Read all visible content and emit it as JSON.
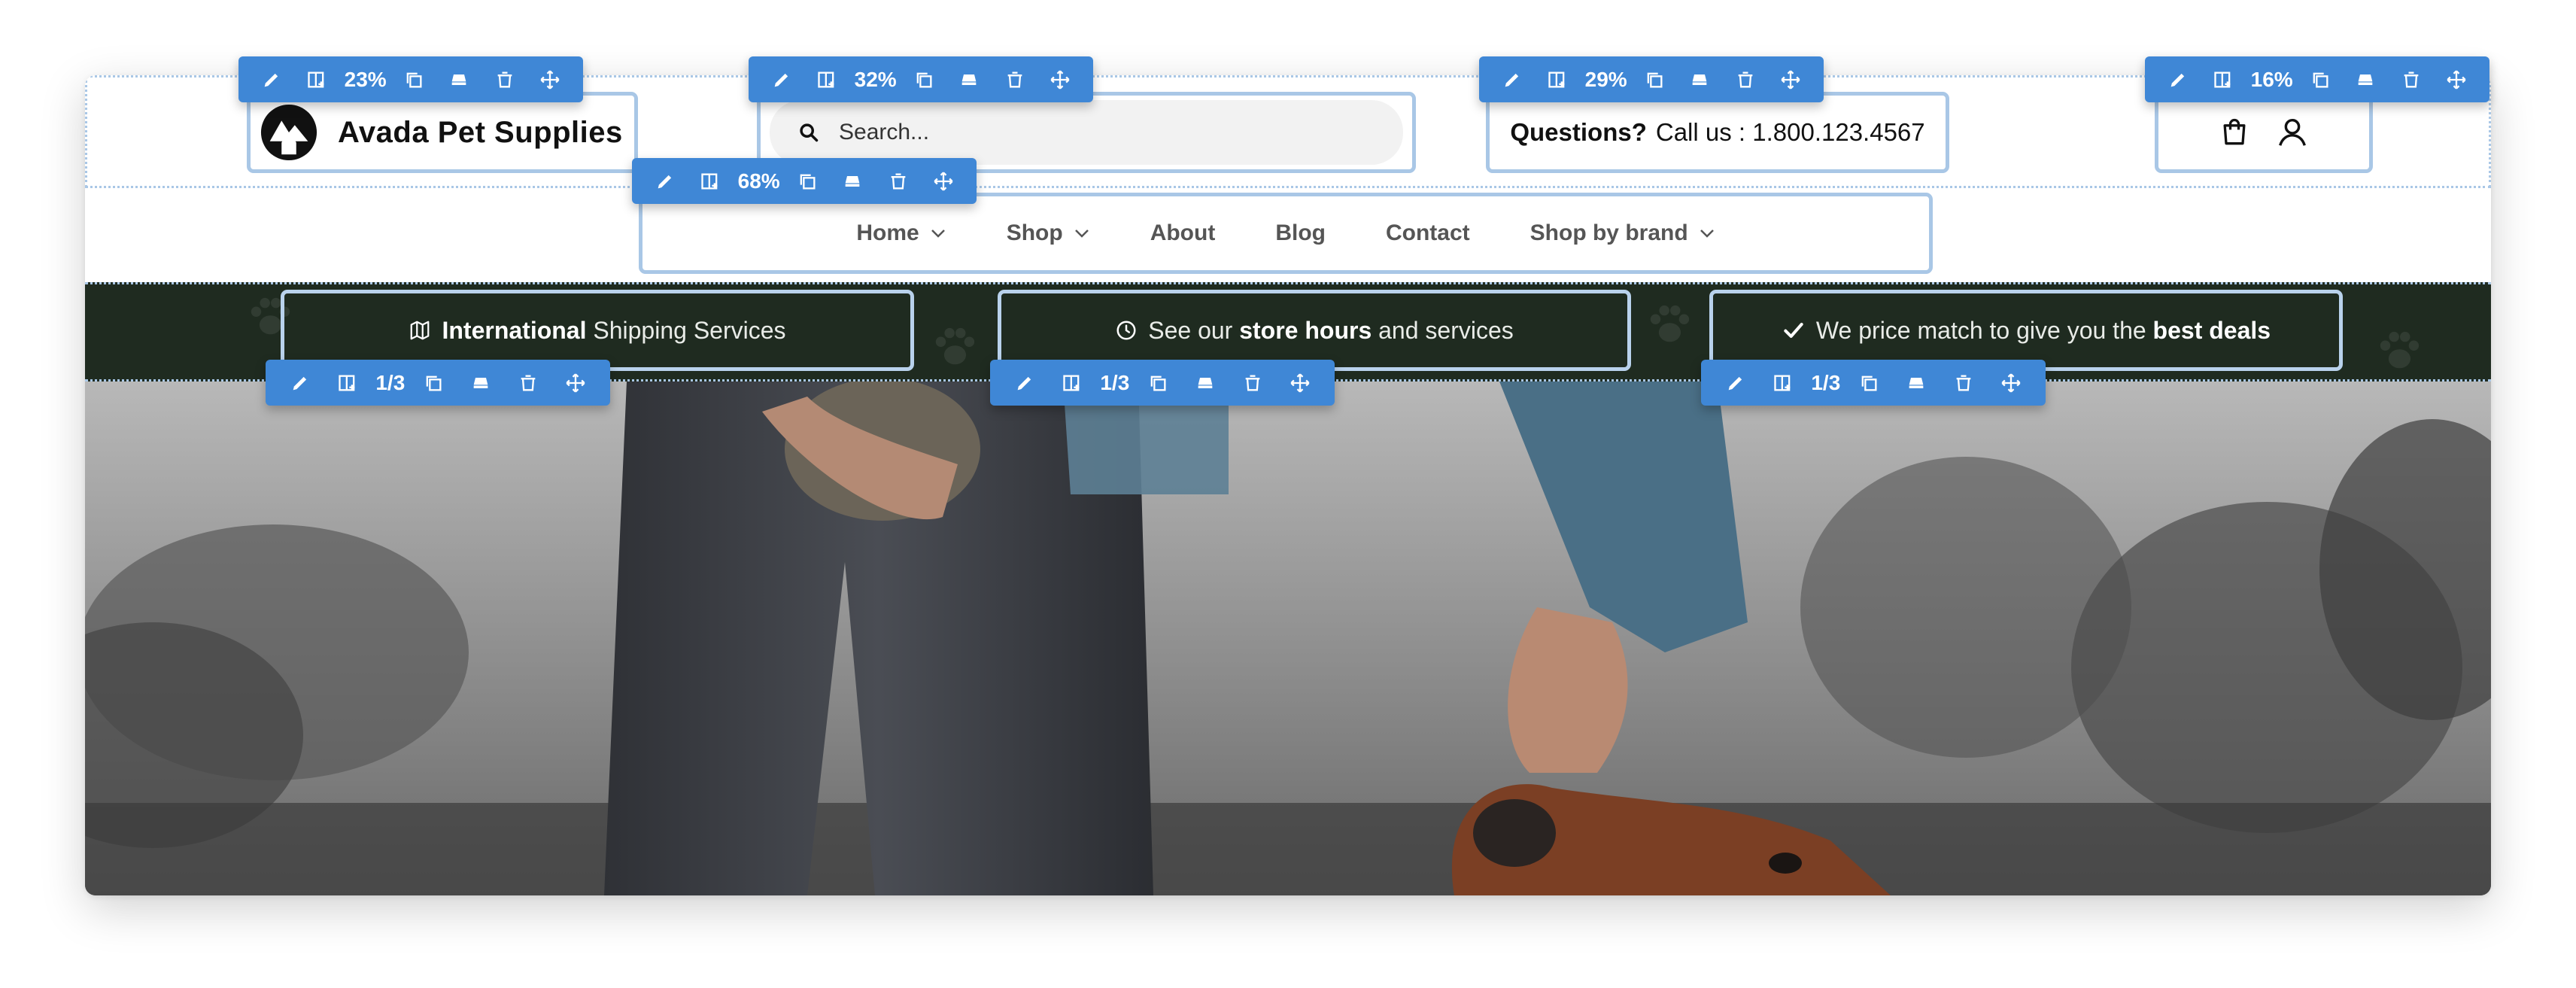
{
  "brand": {
    "name": "Avada Pet Supplies"
  },
  "search": {
    "placeholder": "Search..."
  },
  "contact": {
    "label": "Questions?",
    "text": "Call us : 1.800.123.4567"
  },
  "nav": {
    "items": [
      {
        "label": "Home",
        "has_dropdown": true
      },
      {
        "label": "Shop",
        "has_dropdown": true
      },
      {
        "label": "About",
        "has_dropdown": false
      },
      {
        "label": "Blog",
        "has_dropdown": false
      },
      {
        "label": "Contact",
        "has_dropdown": false
      },
      {
        "label": "Shop by brand",
        "has_dropdown": true
      }
    ]
  },
  "features": [
    {
      "icon": "map-icon",
      "bold": "International",
      "rest": " Shipping Services"
    },
    {
      "icon": "clock-icon",
      "pre": "See our ",
      "bold": "store hours",
      "post": " and services"
    },
    {
      "icon": "check-icon",
      "pre": "We price match to give you the ",
      "bold": "best deals"
    }
  ],
  "toolbars": {
    "brand": "23%",
    "search": "32%",
    "contact": "29%",
    "icons": "16%",
    "nav": "68%",
    "feature_1": "1/3",
    "feature_2": "1/3",
    "feature_3": "1/3"
  },
  "colors": {
    "accent": "#3f87d6",
    "outline": "#a9c7e6",
    "topbar": "#1f2b20"
  }
}
